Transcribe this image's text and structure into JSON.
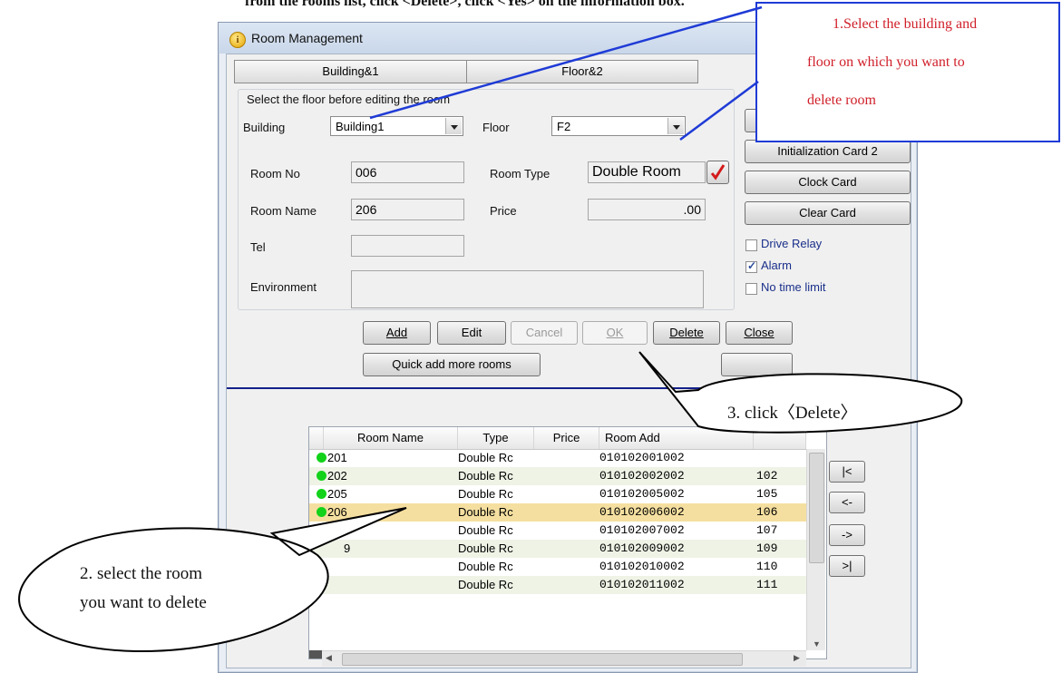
{
  "caption": "from the rooms list, click <Delete>, click <Yes> on the information box.",
  "window": {
    "title": "Room Management",
    "icon": "info-icon"
  },
  "tabs": [
    "Building&1",
    "Floor&2"
  ],
  "select_floor": {
    "group_title": "Select the floor before editing the room",
    "building_label": "Building",
    "building_value": "Building1",
    "floor_label": "Floor",
    "floor_value": "F2"
  },
  "room": {
    "room_no_label": "Room No",
    "room_no": "006",
    "room_type_label": "Room Type",
    "room_type": "Double Room",
    "room_name_label": "Room Name",
    "room_name": "206",
    "price_label": "Price",
    "price": ".00",
    "tel_label": "Tel",
    "tel": "",
    "environment_label": "Environment",
    "environment": ""
  },
  "actions": {
    "add": "Add",
    "edit": "Edit",
    "cancel": "Cancel",
    "ok": "OK",
    "delete": "Delete",
    "close": "Close",
    "quick_add": "Quick add more rooms"
  },
  "cards": {
    "init2": "Initialization Card 2",
    "clock": "Clock Card",
    "clear": "Clear Card"
  },
  "options": [
    {
      "label": "Drive Relay",
      "checked": false
    },
    {
      "label": "Alarm",
      "checked": true
    },
    {
      "label": "No time limit",
      "checked": false
    }
  ],
  "table": {
    "columns": [
      "Room Name",
      "Type",
      "Price",
      "Room Add"
    ],
    "rows": [
      {
        "name": "201",
        "type": "Double Rc",
        "price": "",
        "addr": "010102001002",
        "no": ""
      },
      {
        "name": "202",
        "type": "Double Rc",
        "price": "",
        "addr": "010102002002",
        "no": "102"
      },
      {
        "name": "205",
        "type": "Double Rc",
        "price": "",
        "addr": "010102005002",
        "no": "105"
      },
      {
        "name": "206",
        "type": "Double Rc",
        "price": "",
        "addr": "010102006002",
        "no": "106"
      },
      {
        "name": "",
        "type": "Double Rc",
        "price": "",
        "addr": "010102007002",
        "no": "107"
      },
      {
        "name": "9",
        "type": "Double Rc",
        "price": "",
        "addr": "010102009002",
        "no": "109"
      },
      {
        "name": "",
        "type": "Double Rc",
        "price": "",
        "addr": "010102010002",
        "no": "110"
      },
      {
        "name": "",
        "type": "Double Rc",
        "price": "",
        "addr": "010102011002",
        "no": "111"
      }
    ],
    "selected_index": 3
  },
  "nav": [
    "<-",
    "->",
    ">|"
  ],
  "annotations": {
    "step1_line1": "1.Select the building and",
    "step1_line2": "floor on which you want to",
    "step1_line3": "delete room",
    "step2_line1": "2. select the room",
    "step2_line2": "you want to delete",
    "step3": "3. click〈Delete〉"
  }
}
